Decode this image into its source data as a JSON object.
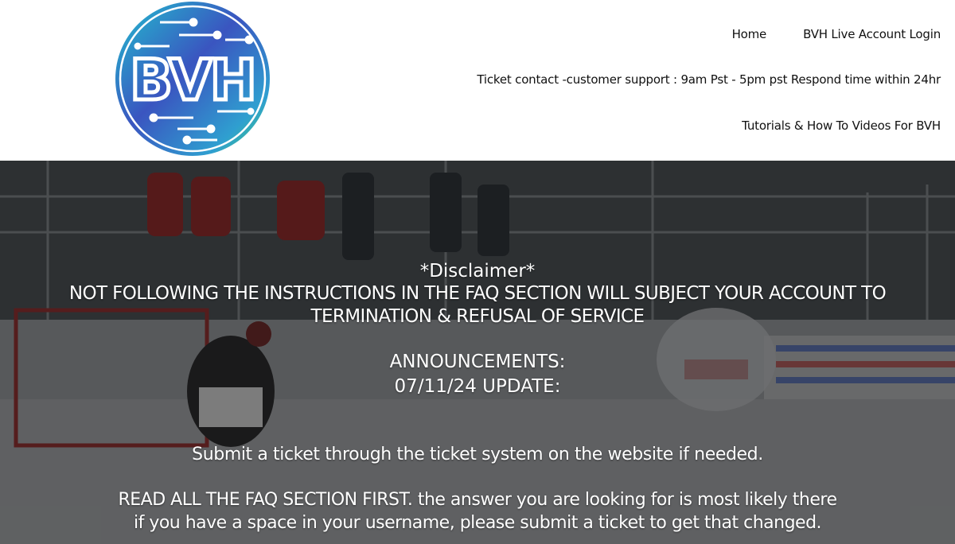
{
  "logo": {
    "text": "BVH"
  },
  "nav": {
    "home": "Home",
    "login": "BVH Live Account Login",
    "ticket_contact": "Ticket contact -customer support : 9am Pst - 5pm pst Respond time within 24hr",
    "tutorials": "Tutorials & How To Videos For BVH"
  },
  "hero": {
    "disclaimer_title": "*Disclaimer*",
    "disclaimer_line1": "NOT FOLLOWING THE INSTRUCTIONS IN THE FAQ SECTION WILL SUBJECT YOUR ACCOUNT TO",
    "disclaimer_line2": "TERMINATION & REFUSAL OF SERVICE",
    "announcements": "ANNOUNCEMENTS:",
    "update": "07/11/24 UPDATE:",
    "submit": "Submit a ticket through the ticket system on the website if needed.",
    "read_faq": "READ ALL THE FAQ SECTION FIRST. the answer you are looking for is most likely there",
    "space_username": "if you have a space in your username, please submit a ticket to get that changed."
  },
  "colors": {
    "logo_gradient_start": "#1fb5c9",
    "logo_gradient_mid": "#3b4fb8",
    "logo_gradient_end": "#3ac96a",
    "nav_text": "#111111",
    "hero_text": "#ffffff"
  }
}
